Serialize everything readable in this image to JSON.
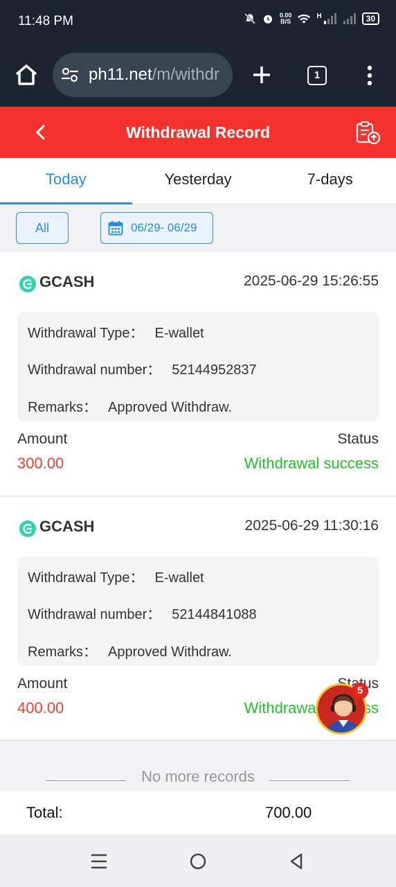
{
  "status_bar": {
    "time": "11:48 PM",
    "net_speed_value": "0.00",
    "net_speed_unit": "B/S",
    "network_label": "H",
    "battery": "30"
  },
  "browser": {
    "url_host": "ph11.net",
    "url_path": "/m/withdr",
    "tab_count": "1"
  },
  "header": {
    "title": "Withdrawal Record"
  },
  "tabs": [
    {
      "label": "Today",
      "active": true
    },
    {
      "label": "Yesterday",
      "active": false
    },
    {
      "label": "7-days",
      "active": false
    }
  ],
  "filter": {
    "all_label": "All",
    "date_range": "06/29- 06/29"
  },
  "records": [
    {
      "provider": "GCASH",
      "datetime": "2025-06-29 15:26:55",
      "type_label": "Withdrawal Type：",
      "type_value": "E-wallet",
      "number_label": "Withdrawal number：",
      "number_value": "52144952837",
      "remarks_label": "Remarks：",
      "remarks_value": "Approved Withdraw.",
      "amount_label": "Amount",
      "amount_value": "300.00",
      "status_label": "Status",
      "status_value": "Withdrawal success"
    },
    {
      "provider": "GCASH",
      "datetime": "2025-06-29 11:30:16",
      "type_label": "Withdrawal Type：",
      "type_value": "E-wallet",
      "number_label": "Withdrawal number：",
      "number_value": "52144841088",
      "remarks_label": "Remarks：",
      "remarks_value": "Approved Withdraw.",
      "amount_label": "Amount",
      "amount_value": "400.00",
      "status_label": "Status",
      "status_value": "Withdrawal success"
    }
  ],
  "footer": {
    "no_more": "No more records",
    "total_label": "Total:",
    "total_value": "700.00"
  },
  "support": {
    "badge_count": "5"
  },
  "colors": {
    "header_red": "#f5332e",
    "accent_blue": "#2a8ee0",
    "amount_red": "#f0402e",
    "success_green": "#22c12a",
    "gcash_teal": "#2bd6b0"
  }
}
